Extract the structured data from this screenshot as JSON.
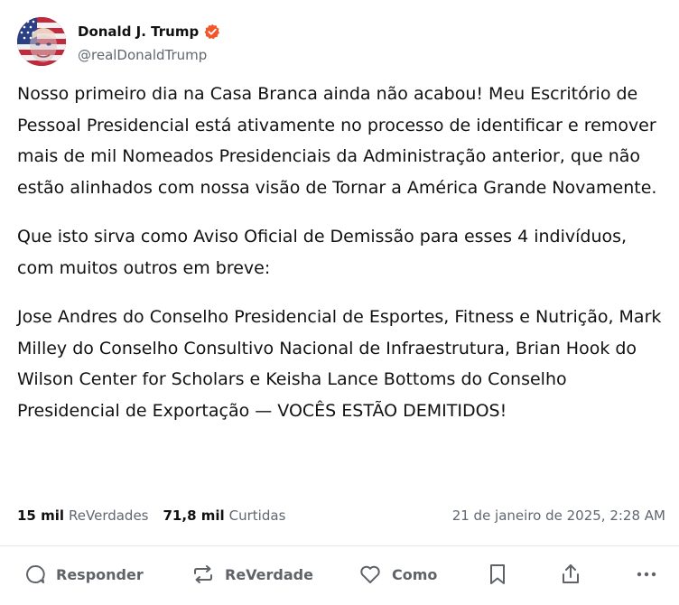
{
  "post": {
    "author": {
      "display_name": "Donald J. Trump",
      "handle": "@realDonaldTrump",
      "verified": true,
      "verified_color": "#F2572A",
      "avatar_icon": "avatar-us-flag-portrait"
    },
    "paragraphs": [
      "Nosso primeiro dia na Casa Branca ainda não acabou! Meu Escritório de Pessoal Presidencial está ativamente no processo de identificar e remover mais de mil Nomeados Presidenciais da Administração anterior, que não estão alinhados com nossa visão de Tornar a América Grande Novamente.",
      "Que isto sirva como Aviso Oficial de Demissão para esses 4 indivíduos, com muitos outros em breve:",
      "Jose Andres do Conselho Presidencial de Esportes, Fitness e Nutrição, Mark Milley do Conselho Consultivo Nacional de Infraestrutura, Brian Hook do Wilson Center for Scholars e Keisha Lance Bottoms do Conselho Presidencial de Exportação — VOCÊS ESTÃO DEMITIDOS!"
    ],
    "stats": {
      "reposts_count": "15 mil",
      "reposts_label": "ReVerdades",
      "likes_count": "71,8 mil",
      "likes_label": "Curtidas"
    },
    "timestamp": "21 de janeiro de 2025, 2:28 AM"
  },
  "actions": {
    "reply_label": "Responder",
    "repost_label": "ReVerdade",
    "like_label": "Como",
    "icons": [
      "comment-icon",
      "repost-icon",
      "heart-icon",
      "bookmark-icon",
      "share-icon",
      "more-icon"
    ]
  },
  "colors": {
    "text": "#111111",
    "muted": "#606770",
    "divider": "#e6e6e8"
  }
}
